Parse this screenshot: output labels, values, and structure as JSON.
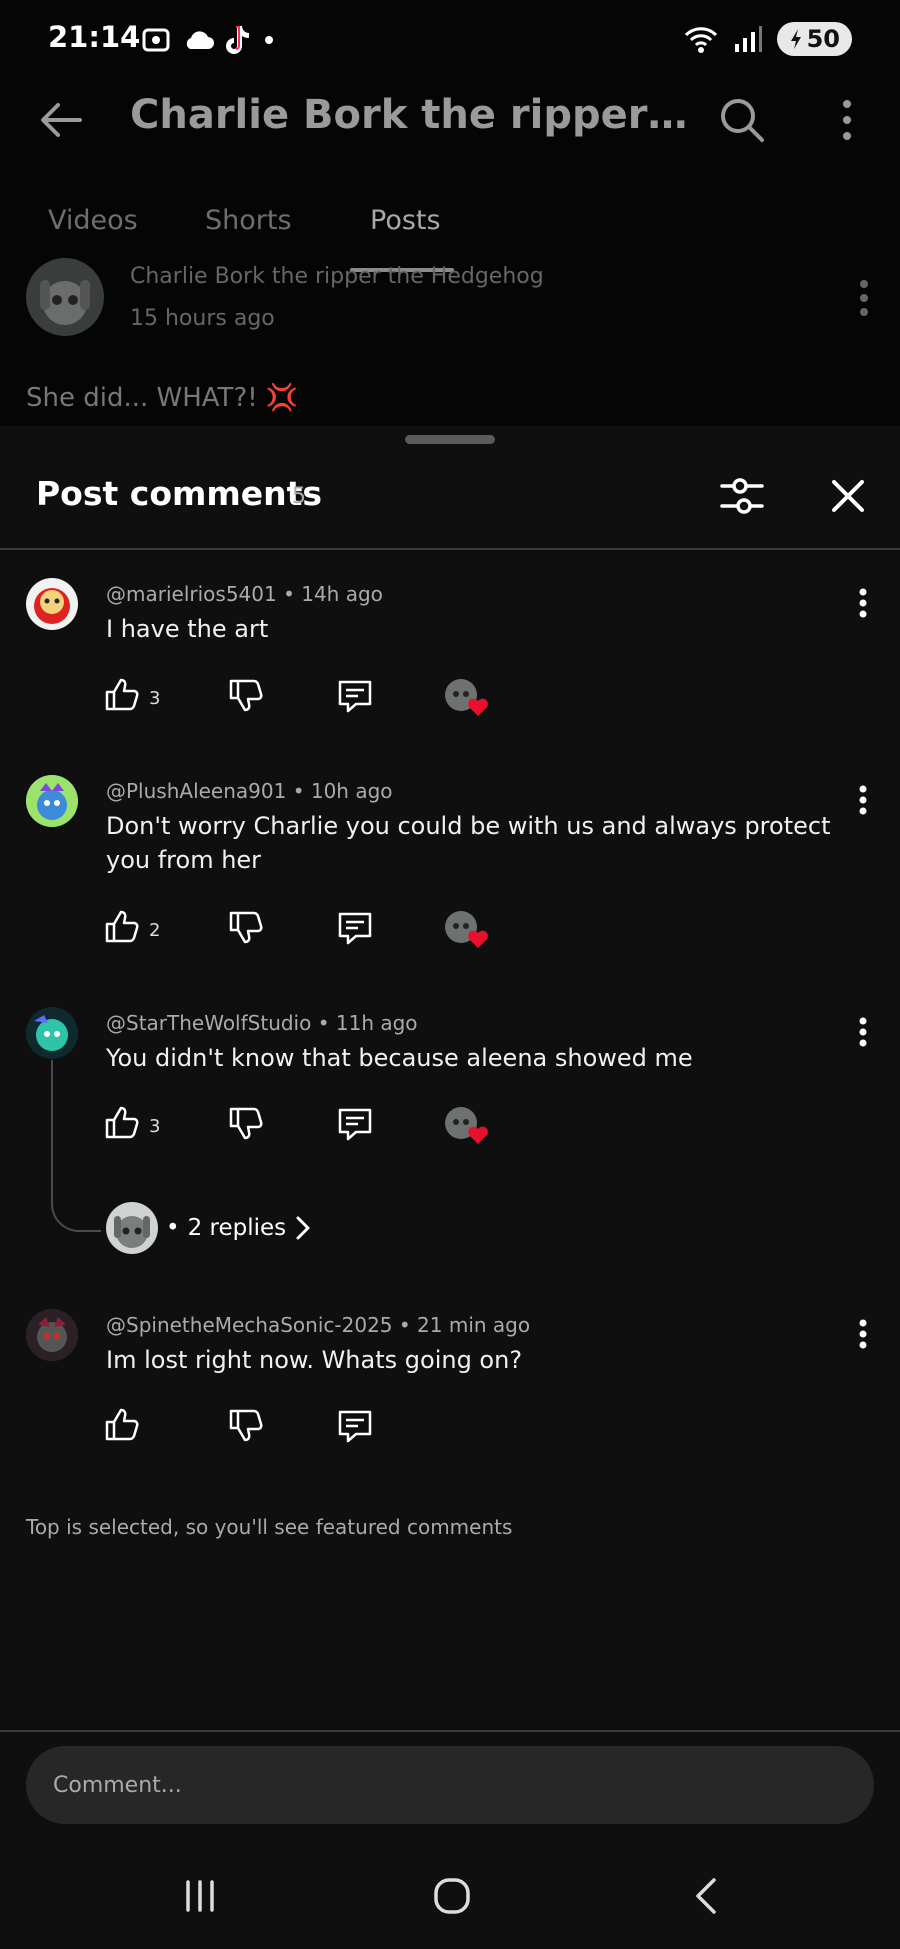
{
  "status_bar": {
    "time": "21:14",
    "battery": "50",
    "icons": [
      "screenshot-icon",
      "cloud-icon",
      "tiktok-icon",
      "dot-icon",
      "wifi-icon",
      "signal-icon",
      "battery-icon"
    ]
  },
  "app_bar": {
    "title": "Charlie Bork the ripper th...",
    "back_icon": "arrow-left-icon",
    "search_icon": "search-icon",
    "more_icon": "more-vertical-icon"
  },
  "tabs": [
    {
      "label": "Videos",
      "active": false
    },
    {
      "label": "Shorts",
      "active": false
    },
    {
      "label": "Posts",
      "active": true
    }
  ],
  "post": {
    "author": "Charlie Bork the ripper the Hedgehog",
    "time": "15 hours ago",
    "text": "She did... WHAT?! 💢"
  },
  "sheet": {
    "title": "Post comments",
    "count": "5"
  },
  "comments": [
    {
      "handle": "@marielrios5401",
      "time": "14h ago",
      "text": "I have the art",
      "likes": "3",
      "hearted": true
    },
    {
      "handle": "@PlushAleena901",
      "time": "10h ago",
      "text": "Don't worry Charlie you could be with us and always protect you from her",
      "likes": "2",
      "hearted": true
    },
    {
      "handle": "@StarTheWolfStudio",
      "time": "11h ago",
      "text": "You didn't know that because aleena showed me",
      "likes": "3",
      "hearted": true,
      "replies": "2 replies"
    },
    {
      "handle": "@SpinetheMechaSonic-2025",
      "time": "21 min ago",
      "text": "Im lost right now. Whats going on?",
      "likes": "",
      "hearted": false
    }
  ],
  "footnote": "Top is selected, so you'll see featured comments",
  "comment_input": {
    "placeholder": "Comment..."
  },
  "colors": {
    "background": "#0f0f0f",
    "heart": "#e8112d",
    "accent_text": "#f1f1f1"
  }
}
